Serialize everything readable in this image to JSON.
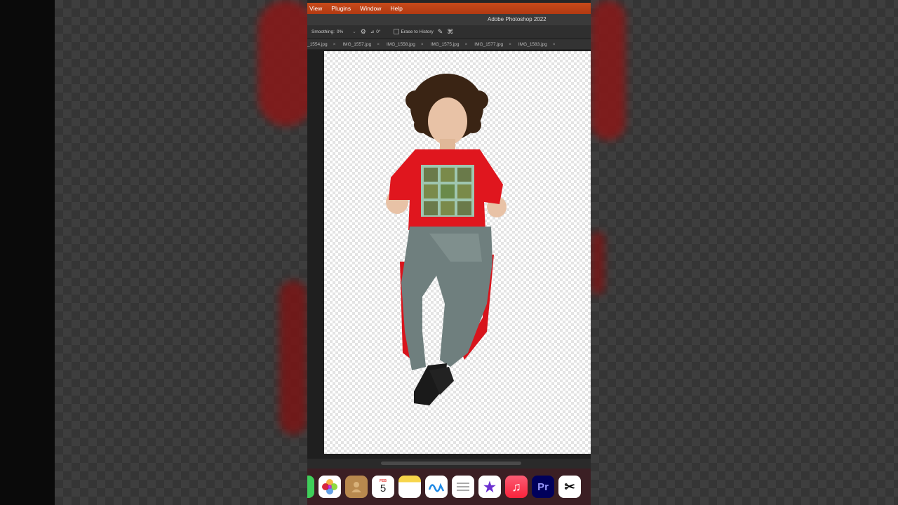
{
  "app": {
    "menu": [
      "View",
      "Plugins",
      "Window",
      "Help"
    ],
    "title": "Adobe Photoshop 2022"
  },
  "options": {
    "smoothing_label": "Smoothing:",
    "smoothing_value": "0%",
    "angle_value": "0°",
    "erase_history_label": "Erase to History"
  },
  "tabs": [
    "_1554.jpg",
    "IMG_1557.jpg",
    "IMG_1558.jpg",
    "IMG_1575.jpg",
    "IMG_1577.jpg",
    "IMG_1583.jpg"
  ],
  "dock": {
    "calendar_month": "FEB",
    "calendar_day": "5",
    "premiere_label": "Pr"
  },
  "colors": {
    "menubar": "#c0441a",
    "shirt": "#e0161e",
    "pants": "#6f7f7e"
  }
}
